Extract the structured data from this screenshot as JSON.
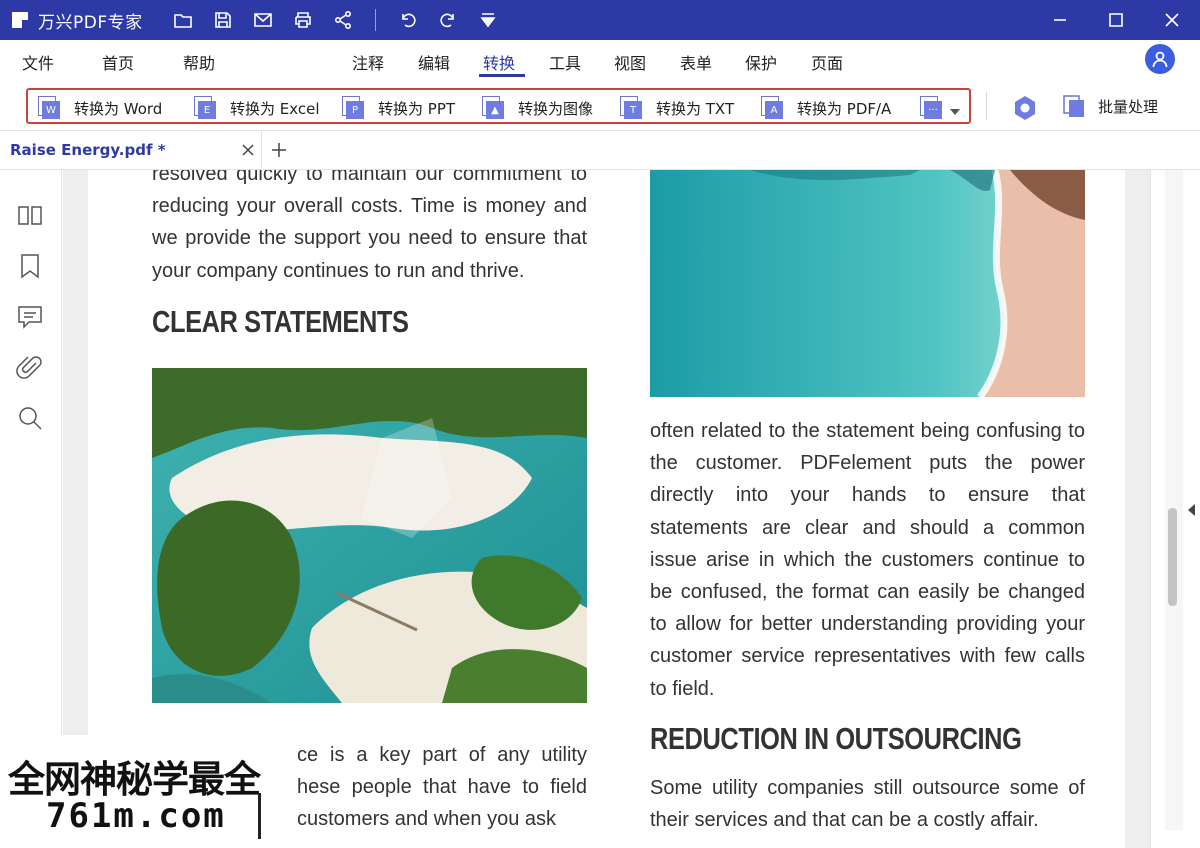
{
  "titlebar": {
    "app_name": "万兴PDF专家"
  },
  "menu": {
    "items": [
      "文件",
      "首页",
      "帮助",
      "注释",
      "编辑",
      "转换",
      "工具",
      "视图",
      "表单",
      "保护",
      "页面"
    ],
    "active": "转换"
  },
  "ribbon": {
    "buttons": [
      {
        "label": "转换为 Word",
        "glyph": "W"
      },
      {
        "label": "转换为 Excel",
        "glyph": "E"
      },
      {
        "label": "转换为 PPT",
        "glyph": "P"
      },
      {
        "label": "转换为图像",
        "glyph": "▲"
      },
      {
        "label": "转换为 TXT",
        "glyph": "T"
      },
      {
        "label": "转换为 PDF/A",
        "glyph": "A"
      },
      {
        "label": "",
        "glyph": "···"
      }
    ],
    "batch_label": "批量处理"
  },
  "tabs": {
    "doc_tab_label": "Raise Energy.pdf *"
  },
  "document": {
    "left_top_para": "resolved quickly to maintain our commitment to reducing your overall costs. Time is money and we provide the support you need to ensure that your company continues to run and thrive.",
    "heading_clear": "CLEAR STATEMENTS",
    "left_bottom_para": "ce is a key part of any utility hese people that have to field customers and when you ask",
    "right_para": "often related to the statement being confusing to the customer. PDFelement puts the power directly into your hands to ensure that statements are clear and should a common issue arise in which the customers continue to be confused, the format can easily be changed to allow for better understanding providing your customer service representatives with few calls to field.",
    "heading_reduction": "REDUCTION IN OUTSOURCING",
    "right_bottom_para": "Some utility companies still outsource some of their services and that can be a costly affair."
  },
  "watermark": {
    "line1": "全网神秘学最全",
    "line2": "761m.com"
  },
  "colors": {
    "brand": "#2d3aa6",
    "ribbon_highlight": "#c8453c",
    "icon_fill": "#6f7ce0"
  }
}
